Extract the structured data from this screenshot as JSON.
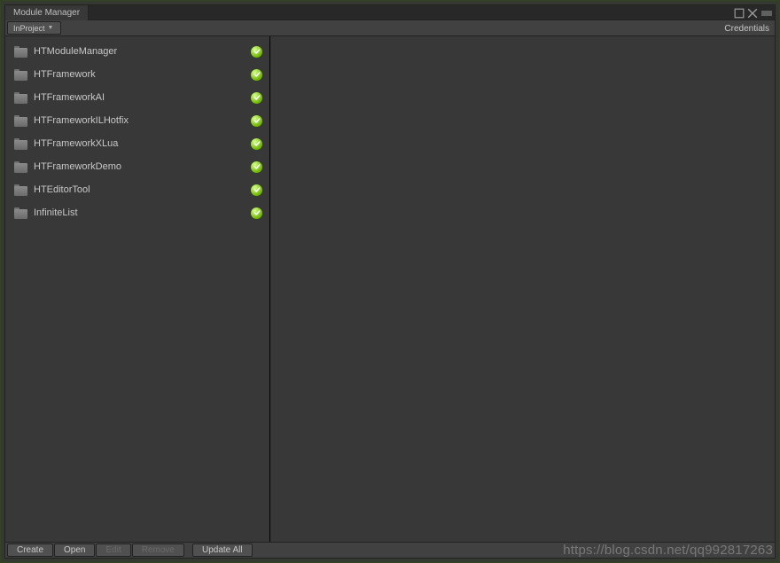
{
  "tab": {
    "title": "Module Manager"
  },
  "window_controls": {
    "popout_name": "popout-icon",
    "close_name": "close-icon",
    "menu_name": "menu-icon"
  },
  "toolbar": {
    "scope_label": "InProject",
    "credentials_label": "Credentials"
  },
  "modules": [
    {
      "name": "HTModuleManager",
      "status": "ok"
    },
    {
      "name": "HTFramework",
      "status": "ok"
    },
    {
      "name": "HTFrameworkAI",
      "status": "ok"
    },
    {
      "name": "HTFrameworkILHotfix",
      "status": "ok"
    },
    {
      "name": "HTFrameworkXLua",
      "status": "ok"
    },
    {
      "name": "HTFrameworkDemo",
      "status": "ok"
    },
    {
      "name": "HTEditorTool",
      "status": "ok"
    },
    {
      "name": "InfiniteList",
      "status": "ok"
    }
  ],
  "footer": {
    "create": "Create",
    "open": "Open",
    "edit": "Edit",
    "remove": "Remove",
    "update_all": "Update All"
  },
  "watermark": "https://blog.csdn.net/qq992817263"
}
